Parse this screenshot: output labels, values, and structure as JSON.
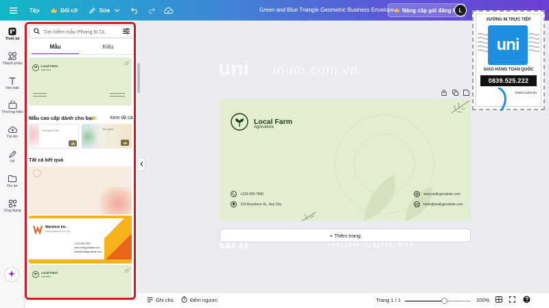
{
  "topbar": {
    "file_label": "Tệp",
    "resize_label": "Đổi cỡ",
    "edit_label": "Sửa",
    "design_title": "Green and Blue Triangle Geometric Business Envelope",
    "upgrade_label": "Nâng cấp gói đăng ký",
    "avatar_initial": "L"
  },
  "rail": {
    "items": [
      {
        "label": "Thiết kế",
        "icon": "layout-icon"
      },
      {
        "label": "Thành phần",
        "icon": "elements-icon"
      },
      {
        "label": "Văn bản",
        "icon": "text-icon"
      },
      {
        "label": "Thương hiệu",
        "icon": "brand-icon"
      },
      {
        "label": "Tải lên",
        "icon": "upload-icon"
      },
      {
        "label": "Vẽ",
        "icon": "draw-icon"
      },
      {
        "label": "Dự án",
        "icon": "folder-icon"
      },
      {
        "label": "Ứng dụng",
        "icon": "apps-icon"
      }
    ]
  },
  "panel": {
    "search_placeholder": "Tìm kiếm mẫu Phong bì DL",
    "tabs": [
      "Mẫu",
      "Kiểu"
    ],
    "premium_heading": "Mẫu cao cấp dành cho bạn",
    "see_all": "Xem tất cả",
    "all_results_heading": "Tất cả kết quả",
    "thumbs": {
      "local_farm_title": "Local Farm",
      "local_farm_sub": "Agriculture",
      "card1_label": "Tên người nhận",
      "card2_label": "Tên người",
      "wardiere_title": "Wardiere Inc.",
      "wardiere_sub": "123 Anywhere St., Any City",
      "wardiere_phone": "+123-456-7890",
      "wardiere_email1": "www.reallygreatsite.com",
      "wardiere_email2": "hello@reallygreatsite.com"
    }
  },
  "canvas": {
    "watermark_text": "inuni.com.vn",
    "watermark_logo": "uni",
    "envelope": {
      "brand": "Local Farm",
      "sub": "Agriculture",
      "phone": "+123-456-7890",
      "address": "123 Anywhere St., Any City",
      "website": "www.reallygreatsite.com",
      "email": "hello@reallygreatsite.com"
    },
    "add_page_label": "+ Thêm trang"
  },
  "bottombar": {
    "notes_label": "Ghi chú",
    "timer_label": "Đếm ngược",
    "page_label": "Trang 1 / 1",
    "zoom_label": "100%",
    "zoom_fraction": 0.6
  },
  "stamp": {
    "top_text": "XƯỞNG IN TRỰC TIẾP",
    "logo_text": "uni",
    "mid_text": "GIAO HÀNG TOÀN QUỐC",
    "phone": "0839.525.222",
    "site": "inuni.com.vn"
  },
  "colors": {
    "accent": "#7d2ae8",
    "highlight_outline": "#d9141f",
    "envelope_bg": "#e3edd2",
    "brand_green": "#1d3b18"
  }
}
